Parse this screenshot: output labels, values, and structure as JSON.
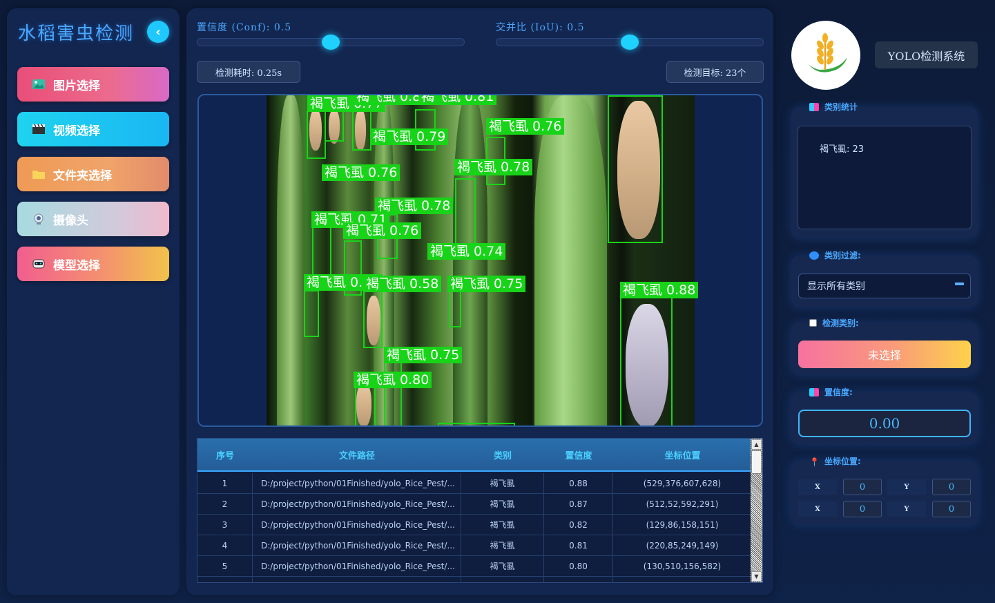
{
  "sidebar": {
    "title": "水稻害虫检测",
    "collapse_icon": "‹",
    "buttons": [
      {
        "label": "图片选择",
        "icon": "image-icon"
      },
      {
        "label": "视频选择",
        "icon": "clapperboard-icon"
      },
      {
        "label": "文件夹选择",
        "icon": "folder-icon"
      },
      {
        "label": "摄像头",
        "icon": "webcam-icon"
      },
      {
        "label": "模型选择",
        "icon": "robot-icon"
      }
    ]
  },
  "controls": {
    "conf_label": "置信度 (Conf): 0.5",
    "conf_value": 0.5,
    "iou_label": "交并比 (IoU): 0.5",
    "iou_value": 0.5,
    "time_label": "检测耗时: 0.25s",
    "count_label": "检测目标: 23个"
  },
  "detections": [
    {
      "label": "褐飞虱 0.77"
    },
    {
      "label": "褐飞虱 0.82"
    },
    {
      "label": "褐飞虱 0.81"
    },
    {
      "label": "褐飞虱 0.79"
    },
    {
      "label": "褐飞虱 0.76"
    },
    {
      "label": "褐飞虱 0.76"
    },
    {
      "label": "褐飞虱 0.78"
    },
    {
      "label": "褐飞虱 0.78"
    },
    {
      "label": "褐飞虱 0.71"
    },
    {
      "label": "褐飞虱 0.76"
    },
    {
      "label": "褐飞虱 0.74"
    },
    {
      "label": "褐飞虱 0.60"
    },
    {
      "label": "褐飞虱 0.58"
    },
    {
      "label": "褐飞虱 0.75"
    },
    {
      "label": "褐飞虱 0.88"
    },
    {
      "label": "褐飞虱 0.75"
    },
    {
      "label": "褐飞虱 0.80"
    }
  ],
  "table": {
    "headers": [
      "序号",
      "文件路径",
      "类别",
      "置信度",
      "坐标位置"
    ],
    "rows": [
      [
        "1",
        "D:/project/python/01Finished/yolo_Rice_Pest/...",
        "褐飞虱",
        "0.88",
        "(529,376,607,628)"
      ],
      [
        "2",
        "D:/project/python/01Finished/yolo_Rice_Pest/...",
        "褐飞虱",
        "0.87",
        "(512,52,592,291)"
      ],
      [
        "3",
        "D:/project/python/01Finished/yolo_Rice_Pest/...",
        "褐飞虱",
        "0.82",
        "(129,86,158,151)"
      ],
      [
        "4",
        "D:/project/python/01Finished/yolo_Rice_Pest/...",
        "褐飞虱",
        "0.81",
        "(220,85,249,149)"
      ],
      [
        "5",
        "D:/project/python/01Finished/yolo_Rice_Pest/...",
        "褐飞虱",
        "0.80",
        "(130,510,156,582)"
      ]
    ]
  },
  "right": {
    "system_title": "YOLO检测系统",
    "stats_title": "类别统计",
    "stats_text": "褐飞虱: 23",
    "filter_title": "类别过滤:",
    "filter_value": "显示所有类别",
    "detect_class_title": "检测类别:",
    "detect_class_value": "未选择",
    "conf_title": "置信度:",
    "conf_value": "0.00",
    "coord_title": "坐标位置:",
    "coords": [
      {
        "label": "X",
        "value": "0"
      },
      {
        "label": "Y",
        "value": "0"
      },
      {
        "label": "X",
        "value": "0"
      },
      {
        "label": "Y",
        "value": "0"
      }
    ]
  },
  "colors": {
    "accent": "#4aa8ff",
    "box": "#18d418",
    "panel": "#132650"
  }
}
